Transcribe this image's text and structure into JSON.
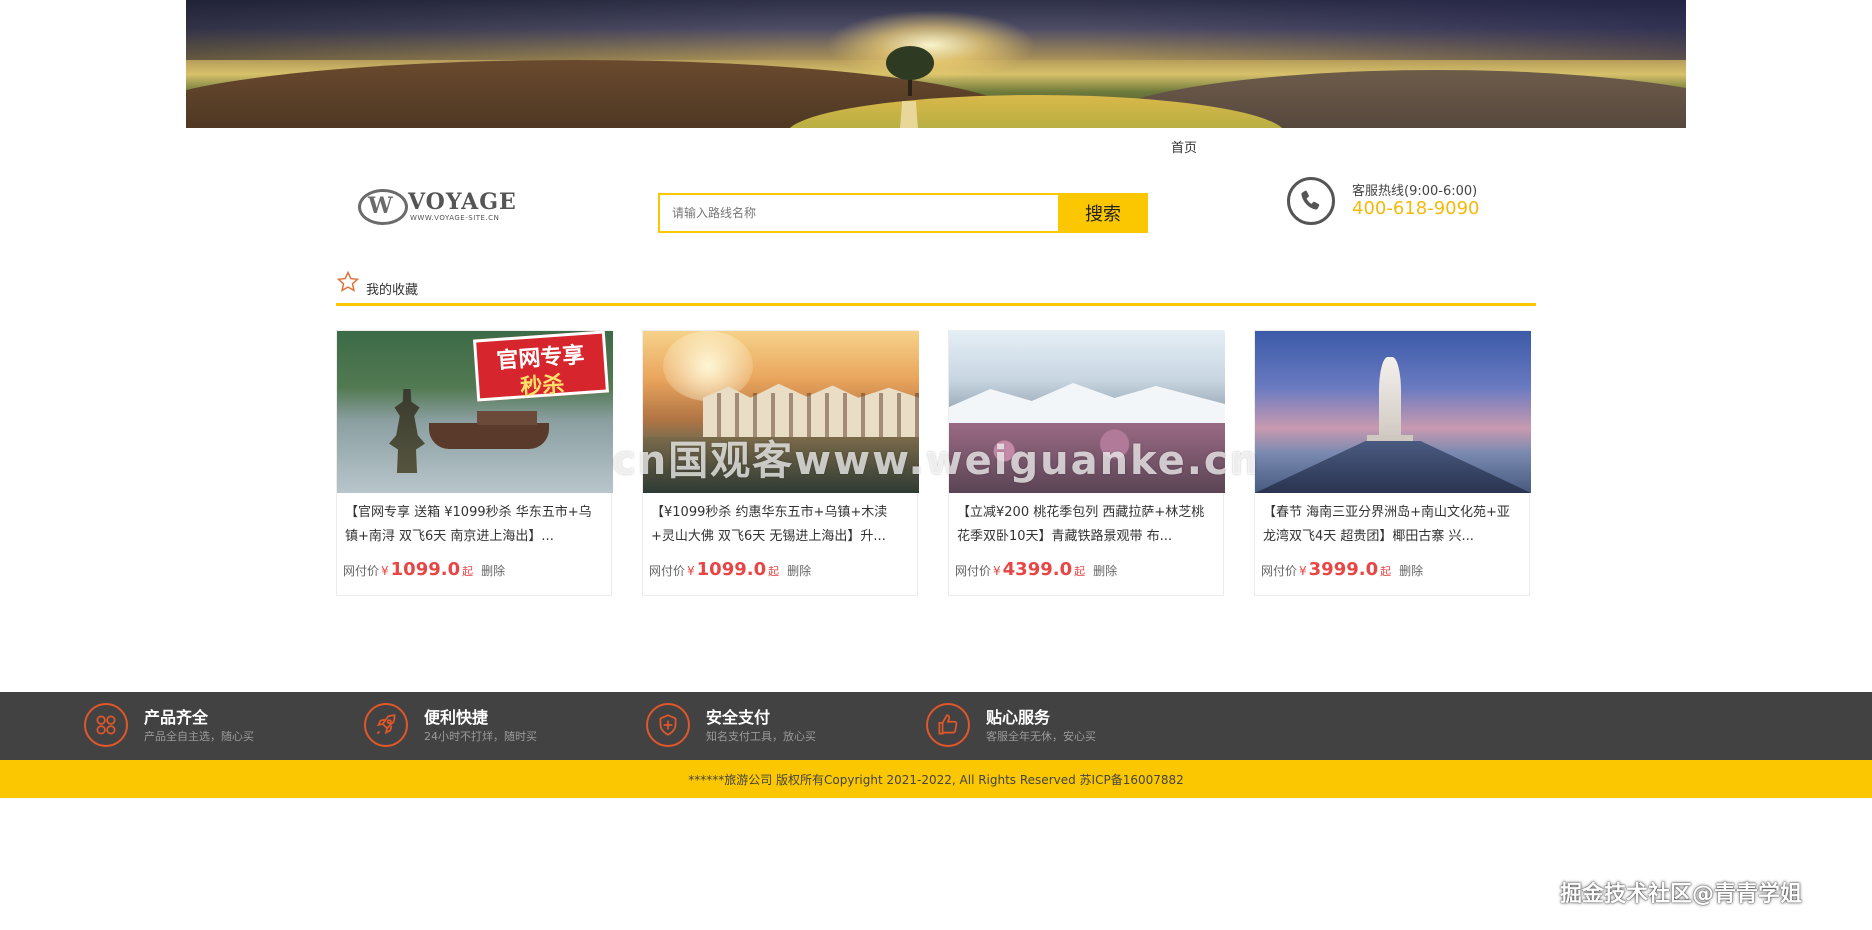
{
  "nav": {
    "home": "首页"
  },
  "logo": {
    "brand": "VOYAGE",
    "sub": "WWW.VOYAGE-SITE.CN"
  },
  "search": {
    "placeholder": "请输入路线名称",
    "button": "搜索"
  },
  "hotline": {
    "label": "客服热线(9:00-6:00)",
    "number": "400-618-9090"
  },
  "favorites": {
    "title": "我的收藏"
  },
  "cards": [
    {
      "title": "【官网专享 送箱 ¥1099秒杀 华东五市+乌镇+南浔 双飞6天 南京进上海出】...",
      "price_label": "网付价",
      "currency": "¥",
      "price": "1099.0",
      "suffix": "起",
      "delete": "删除",
      "promo_line1": "官网专享",
      "promo_line2": "秒杀"
    },
    {
      "title": "【¥1099秒杀 约惠华东五市+乌镇+木渎+灵山大佛 双飞6天 无锡进上海出】升...",
      "price_label": "网付价",
      "currency": "¥",
      "price": "1099.0",
      "suffix": "起",
      "delete": "删除"
    },
    {
      "title": "【立减¥200 桃花季包列 西藏拉萨+林芝桃花季双卧10天】青藏铁路景观带 布...",
      "price_label": "网付价",
      "currency": "¥",
      "price": "4399.0",
      "suffix": "起",
      "delete": "删除"
    },
    {
      "title": "【春节 海南三亚分界洲岛+南山文化苑+亚龙湾双飞4天 超贵团】椰田古寨 兴...",
      "price_label": "网付价",
      "currency": "¥",
      "price": "3999.0",
      "suffix": "起",
      "delete": "删除"
    }
  ],
  "watermark": "cn国观客www.weiguanke.cn",
  "features": [
    {
      "title": "产品齐全",
      "sub": "产品全自主选，随心买",
      "icon": "grid-icon"
    },
    {
      "title": "便利快捷",
      "sub": "24小时不打烊，随时买",
      "icon": "rocket-icon"
    },
    {
      "title": "安全支付",
      "sub": "知名支付工具，放心买",
      "icon": "shield-icon"
    },
    {
      "title": "贴心服务",
      "sub": "客服全年无休，安心买",
      "icon": "thumbs-up-icon"
    }
  ],
  "copyright": "******旅游公司 版权所有Copyright 2021-2022, All Rights Reserved 苏ICP备16007882",
  "credit": "掘金技术社区@青青学姐",
  "colors": {
    "accent": "#fbc700",
    "price": "#e84545",
    "footer_dark": "#424242",
    "feature_icon": "#e0572a",
    "hotline": "#f5b90a"
  }
}
